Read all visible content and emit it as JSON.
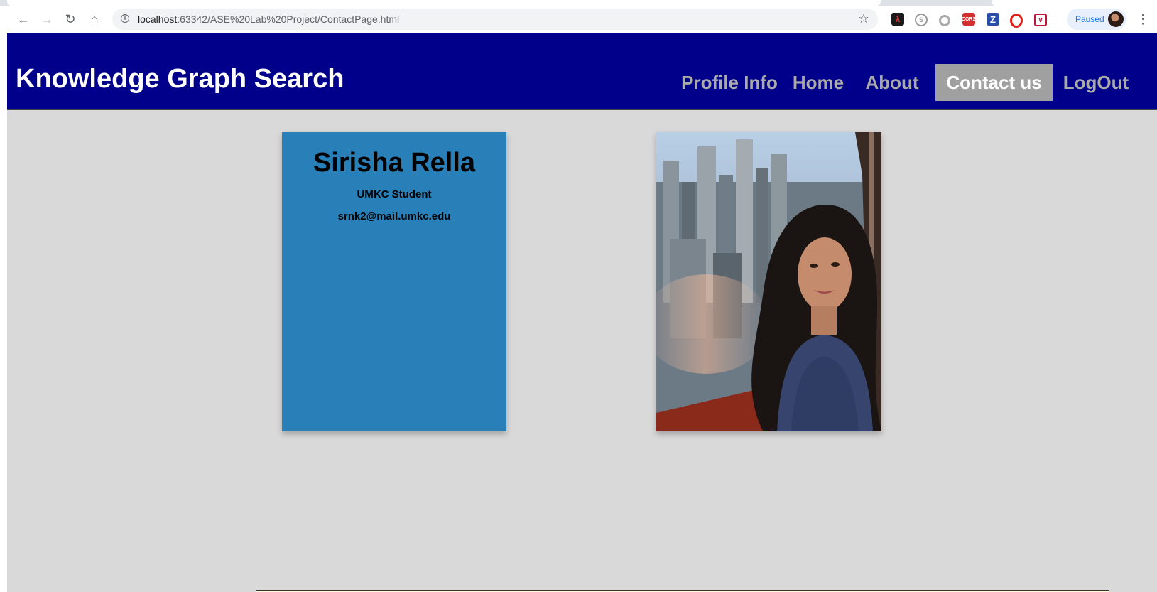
{
  "browser": {
    "url_host": "localhost",
    "url_rest": ":63342/ASE%20Lab%20Project/ContactPage.html",
    "profile_status": "Paused",
    "extensions": [
      "acrobat-icon",
      "skype-icon",
      "circle-ext-icon",
      "cors-icon",
      "zotero-icon",
      "opera-icon",
      "pocket-icon"
    ],
    "extension_labels": {
      "cors": "CORS",
      "zotero": "Z"
    }
  },
  "header": {
    "title": "Knowledge Graph Search",
    "bg_color": "#00008b"
  },
  "nav": {
    "items": [
      {
        "label": "Profile Info",
        "active": false
      },
      {
        "label": "Home",
        "active": false
      },
      {
        "label": "About",
        "active": false
      },
      {
        "label": "Contact us",
        "active": true
      },
      {
        "label": "LogOut",
        "active": false
      }
    ],
    "active_bg": "#a0a0a0",
    "inactive_color": "#aaaaaa"
  },
  "profile_card": {
    "name": "Sirisha Rella",
    "role": "UMKC Student",
    "email": "srnk2@mail.umkc.edu",
    "bg_color": "#2980b9"
  },
  "photo": {
    "alt": "profile photo"
  },
  "page_bg": "#d9d9d9"
}
